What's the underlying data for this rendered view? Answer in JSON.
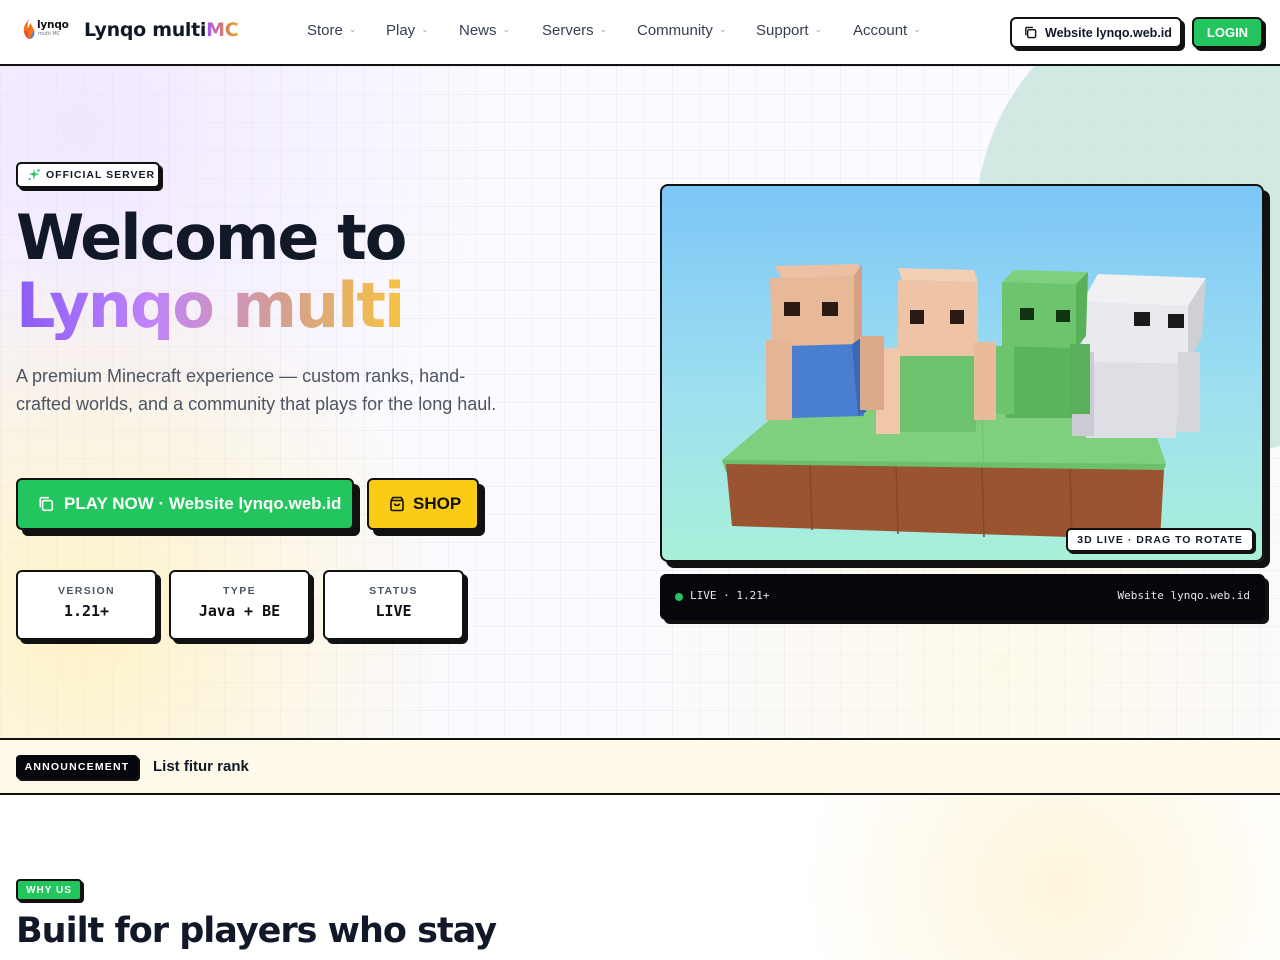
{
  "brand": {
    "logo_text": "lynqo",
    "logo_sub": "multi MC",
    "name_main": "Lynqo multi",
    "name_accent": "MC"
  },
  "nav": {
    "items": [
      {
        "label": "Store"
      },
      {
        "label": "Play"
      },
      {
        "label": "News"
      },
      {
        "label": "Servers"
      },
      {
        "label": "Community"
      },
      {
        "label": "Support"
      },
      {
        "label": "Account"
      }
    ],
    "copy_label": "Website lynqo.web.id",
    "login_label": "LOGIN"
  },
  "hero": {
    "badge": "OFFICIAL SERVER",
    "title_line1": "Welcome to",
    "title_line2": "Lynqo multi",
    "lead": "A premium Minecraft experience — custom ranks, hand-crafted worlds, and a community that plays for the long haul.",
    "play_label": "PLAY NOW · Website lynqo.web.id",
    "shop_label": "SHOP",
    "stats": [
      {
        "label": "VERSION",
        "value": "1.21+"
      },
      {
        "label": "TYPE",
        "value": "Java + BE"
      },
      {
        "label": "STATUS",
        "value": "LIVE"
      }
    ],
    "viewer_tag": "3D LIVE · DRAG TO ROTATE",
    "console_left": "LIVE · 1.21+",
    "console_right": "Website lynqo.web.id"
  },
  "announcement": {
    "tag": "ANNOUNCEMENT",
    "message": "List fitur rank"
  },
  "why": {
    "tag": "WHY US",
    "heading": "Built for players who stay"
  },
  "colors": {
    "primary_green": "#22c55e",
    "accent_yellow": "#facc15",
    "ink": "#111111",
    "gradient_start": "#8b5cf6",
    "gradient_end": "#f6c343"
  }
}
